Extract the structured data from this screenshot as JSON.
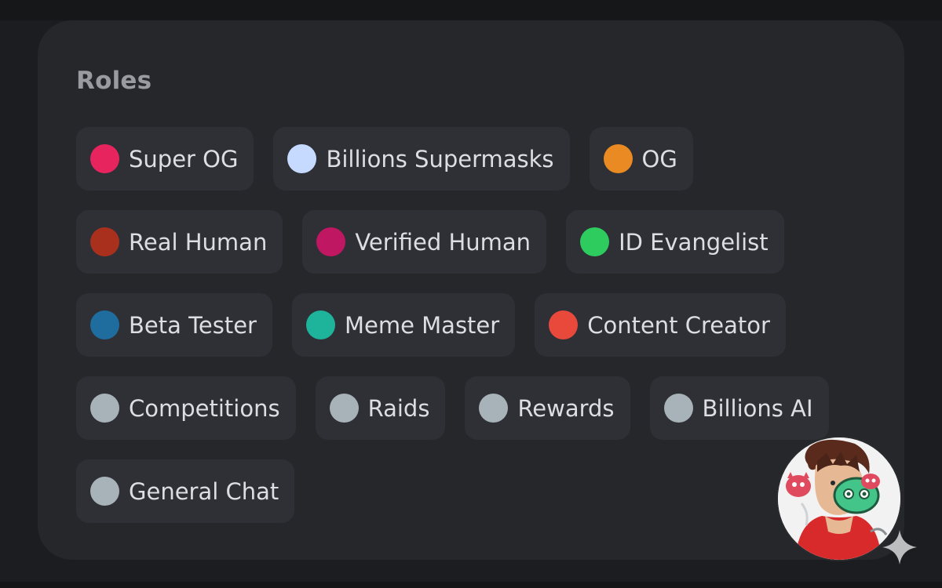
{
  "roles_panel": {
    "heading": "Roles",
    "rows": [
      [
        {
          "label": "Super OG",
          "color": "#e8245e"
        },
        {
          "label": "Billions Supermasks",
          "color": "#c6d9ff"
        },
        {
          "label": "OG",
          "color": "#e98a23"
        }
      ],
      [
        {
          "label": "Real Human",
          "color": "#a8301d"
        },
        {
          "label": "Verified Human",
          "color": "#bf1762"
        },
        {
          "label": "ID Evangelist",
          "color": "#2ecc5e"
        }
      ],
      [
        {
          "label": "Beta Tester",
          "color": "#1f6c9e"
        },
        {
          "label": "Meme Master",
          "color": "#1eb39b"
        },
        {
          "label": "Content Creator",
          "color": "#e8493a"
        }
      ],
      [
        {
          "label": "Competitions",
          "color": "#a8b2b9"
        },
        {
          "label": "Raids",
          "color": "#a8b2b9"
        },
        {
          "label": "Rewards",
          "color": "#a8b2b9"
        },
        {
          "label": "Billions AI",
          "color": "#a8b2b9"
        }
      ],
      [
        {
          "label": "General Chat",
          "color": "#a8b2b9"
        }
      ]
    ]
  },
  "avatar": {
    "icon": "anime-character-avatar"
  },
  "watermark": {
    "icon": "sparkle-icon"
  }
}
